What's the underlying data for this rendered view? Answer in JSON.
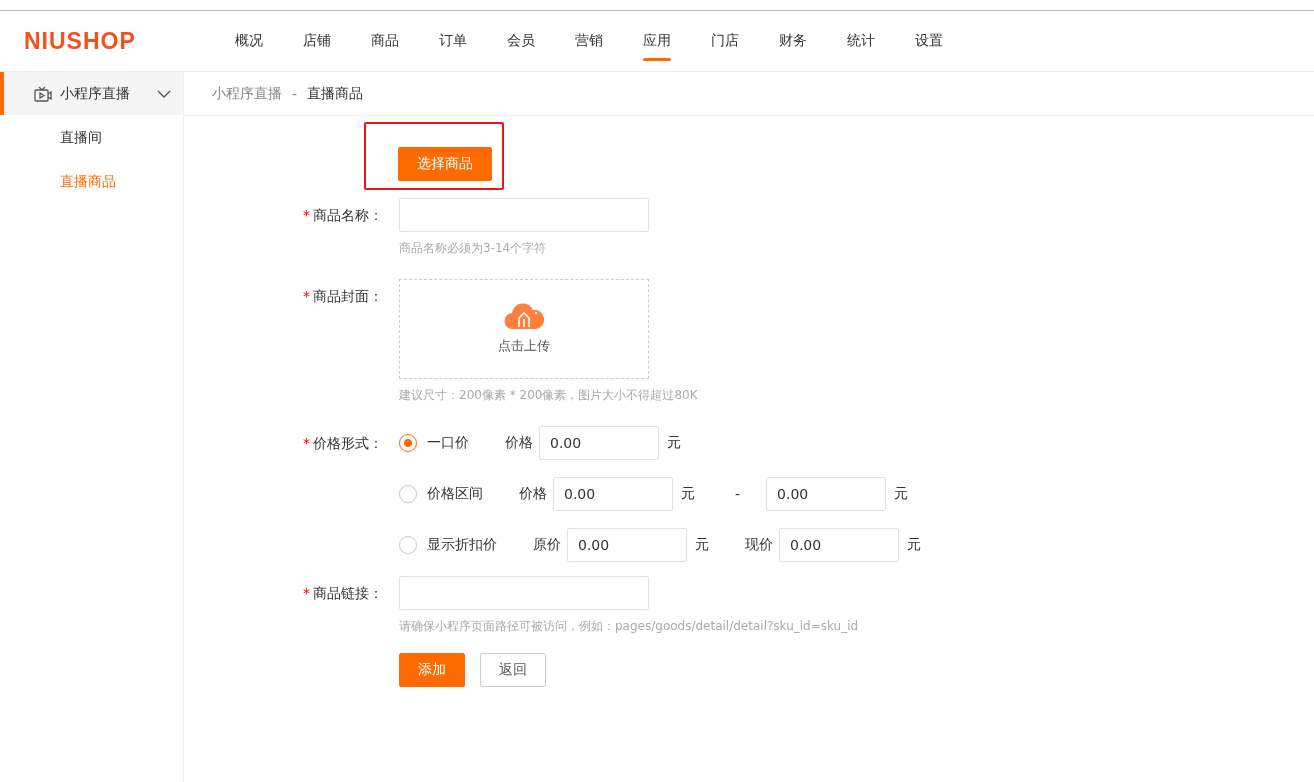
{
  "header": {
    "logo": "NIUSHOP",
    "nav": [
      {
        "label": "概况",
        "selected": false
      },
      {
        "label": "店铺",
        "selected": false
      },
      {
        "label": "商品",
        "selected": false
      },
      {
        "label": "订单",
        "selected": false
      },
      {
        "label": "会员",
        "selected": false
      },
      {
        "label": "营销",
        "selected": false
      },
      {
        "label": "应用",
        "selected": true
      },
      {
        "label": "门店",
        "selected": false
      },
      {
        "label": "财务",
        "selected": false
      },
      {
        "label": "统计",
        "selected": false
      },
      {
        "label": "设置",
        "selected": false
      }
    ]
  },
  "sidebar": {
    "group": {
      "label": "小程序直播",
      "expanded": true,
      "items": [
        {
          "label": "直播间",
          "selected": false
        },
        {
          "label": "直播商品",
          "selected": true
        }
      ]
    }
  },
  "breadcrumb": [
    "小程序直播",
    "直播商品"
  ],
  "breadcrumb_separator": "-",
  "form": {
    "select_button": "选择商品",
    "name": {
      "label": "商品名称：",
      "required_mark": "*",
      "hint": "商品名称必须为3-14个字符"
    },
    "cover": {
      "label": "商品封面：",
      "required_mark": "*",
      "upload_text": "点击上传",
      "hint": "建议尺寸：200像素 * 200像素，图片大小不得超过80K"
    },
    "price": {
      "label": "价格形式：",
      "required_mark": "*",
      "options": [
        {
          "label": "一口价",
          "selected": true,
          "parts": [
            {
              "kind": "label",
              "text": "价格"
            },
            {
              "kind": "input",
              "value": "0.00"
            },
            {
              "kind": "unit",
              "text": "元"
            }
          ]
        },
        {
          "label": "价格区间",
          "selected": false,
          "parts": [
            {
              "kind": "label",
              "text": "价格"
            },
            {
              "kind": "input",
              "value": "0.00"
            },
            {
              "kind": "unit",
              "text": "元"
            },
            {
              "kind": "separator",
              "text": "-"
            },
            {
              "kind": "input",
              "value": "0.00"
            },
            {
              "kind": "unit",
              "text": "元"
            }
          ]
        },
        {
          "label": "显示折扣价",
          "selected": false,
          "parts": [
            {
              "kind": "label",
              "text": "原价"
            },
            {
              "kind": "input",
              "value": "0.00"
            },
            {
              "kind": "unit",
              "text": "元"
            },
            {
              "kind": "label",
              "text": "现价"
            },
            {
              "kind": "input",
              "value": "0.00"
            },
            {
              "kind": "unit",
              "text": "元"
            }
          ]
        }
      ]
    },
    "link": {
      "label": "商品链接：",
      "required_mark": "*",
      "hint": "请确保小程序页面路径可被访问，例如：pages/goods/detail/detail?sku_id=sku_id"
    },
    "buttons": [
      {
        "label": "添加",
        "kind": "primary"
      },
      {
        "label": "返回",
        "kind": "default"
      }
    ]
  }
}
